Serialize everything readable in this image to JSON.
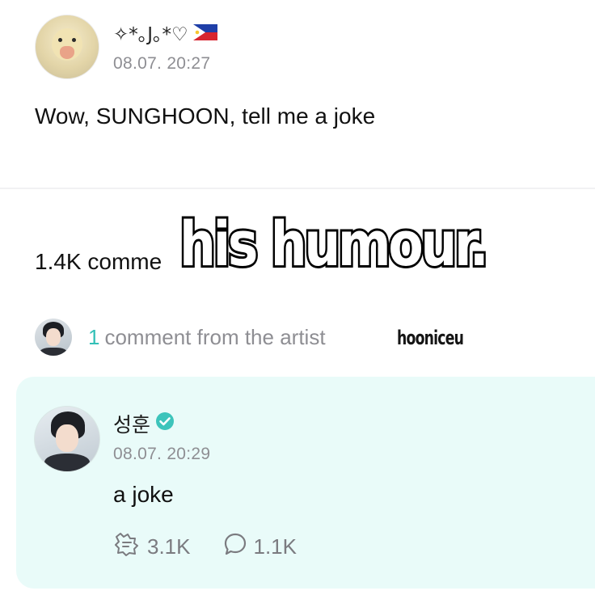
{
  "post": {
    "username": "✧*｡J｡*♡",
    "flag_icon": "philippines-flag-icon",
    "time": "08.07. 20:27",
    "body": "Wow, SUNGHOON, tell me a joke"
  },
  "comments": {
    "count_label": "1.4K comme"
  },
  "overlay": {
    "caption": "his humour."
  },
  "artist_section": {
    "count": "1",
    "label": "comment from the artist",
    "watermark": "hooniceu"
  },
  "reply": {
    "name": "성훈",
    "verified_icon": "verified-badge-icon",
    "time": "08.07. 20:29",
    "body": "a joke",
    "likes": "3.1K",
    "replies": "1.1K"
  },
  "colors": {
    "accent": "#33c0b7",
    "card_bg": "#e9fbf9",
    "muted": "#8e8e93"
  }
}
